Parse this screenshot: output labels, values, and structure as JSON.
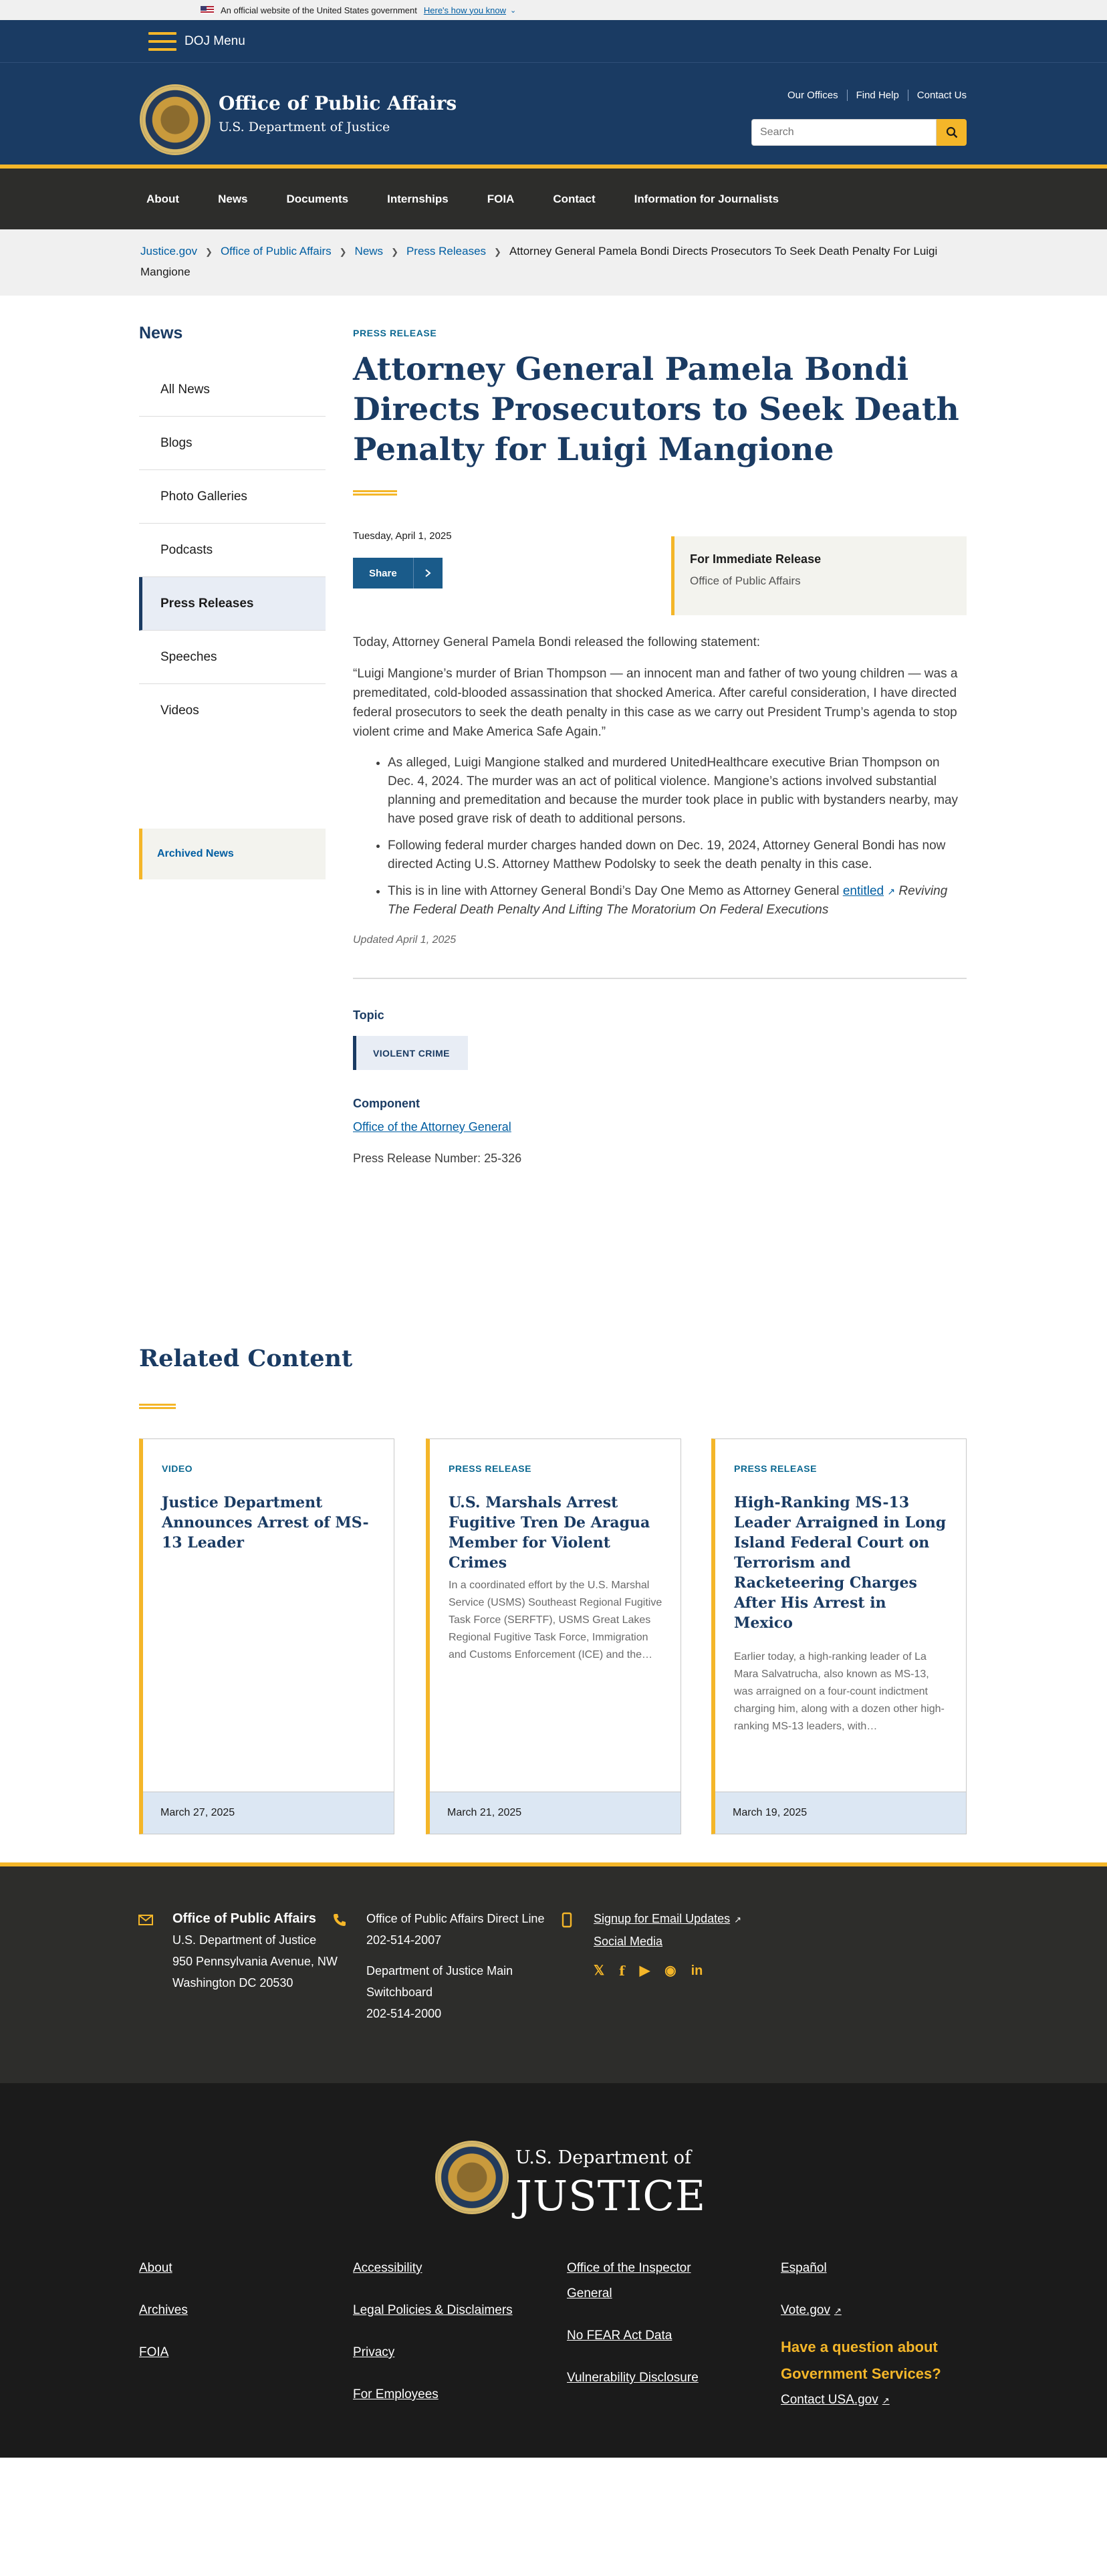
{
  "gov_banner": {
    "text": "An official website of the United States government",
    "link": "Here's how you know"
  },
  "menu": {
    "label": "DOJ Menu"
  },
  "header": {
    "title": "Office of Public Affairs",
    "subtitle": "U.S. Department of Justice",
    "util_links": [
      "Our Offices",
      "Find Help",
      "Contact Us"
    ],
    "search_placeholder": "Search"
  },
  "nav": [
    "About",
    "News",
    "Documents",
    "Internships",
    "FOIA",
    "Contact",
    "Information for Journalists"
  ],
  "breadcrumb": {
    "items": [
      "Justice.gov",
      "Office of Public Affairs",
      "News",
      "Press Releases"
    ],
    "current": "Attorney General Pamela Bondi Directs Prosecutors To Seek Death Penalty For Luigi Mangione"
  },
  "sidebar": {
    "title": "News",
    "items": [
      "All News",
      "Blogs",
      "Photo Galleries",
      "Podcasts",
      "Press Releases",
      "Speeches",
      "Videos"
    ],
    "active": "Press Releases",
    "archived": "Archived News"
  },
  "article": {
    "eyebrow": "PRESS RELEASE",
    "title": "Attorney General Pamela Bondi Directs Prosecutors to Seek Death Penalty for Luigi Mangione",
    "date": "Tuesday, April 1, 2025",
    "share": "Share",
    "release_title": "For Immediate Release",
    "release_office": "Office of Public Affairs",
    "intro": "Today, Attorney General Pamela Bondi released the following statement:",
    "quote": "“Luigi Mangione’s murder of Brian Thompson — an innocent man and father of two young children — was a premeditated, cold-blooded assassination that shocked America. After careful consideration, I have directed federal prosecutors to seek the death penalty in this case as we carry out President Trump’s agenda to stop violent crime and Make America Safe Again.”",
    "bullets": [
      "As alleged, Luigi Mangione stalked and murdered UnitedHealthcare executive Brian Thompson on Dec. 4, 2024. The murder was an act of political violence. Mangione’s actions involved substantial planning and premeditation and because the murder took place in public with bystanders nearby, may have posed grave risk of death to additional persons.",
      "Following federal murder charges handed down on Dec. 19, 2024, Attorney General Bondi has now directed Acting U.S. Attorney Matthew Podolsky to seek the death penalty in this case."
    ],
    "bullet3_prefix": "This is in line with Attorney General Bondi’s Day One Memo as Attorney General ",
    "bullet3_link": "entitled",
    "bullet3_italic": "Reviving The Federal Death Penalty And Lifting The Moratorium On Federal Executions",
    "updated": "Updated April 1, 2025",
    "topic_label": "Topic",
    "topic": "VIOLENT CRIME",
    "component_label": "Component",
    "component": "Office of the Attorney General",
    "release_number": "Press Release Number: 25-326"
  },
  "related": {
    "title": "Related Content",
    "cards": [
      {
        "type": "VIDEO",
        "title": "Justice Department Announces Arrest of MS-13 Leader",
        "desc": "",
        "date": "March 27, 2025"
      },
      {
        "type": "PRESS RELEASE",
        "title": "U.S. Marshals Arrest Fugitive Tren De Aragua Member for Violent Crimes",
        "desc": "In a coordinated effort by the U.S. Marshal Service (USMS) Southeast Regional Fugitive Task Force (SERFTF), USMS Great Lakes Regional Fugitive Task Force, Immigration and Customs Enforcement (ICE) and the…",
        "date": "March 21, 2025"
      },
      {
        "type": "PRESS RELEASE",
        "title": "High-Ranking MS-13 Leader Arraigned in Long Island Federal Court on Terrorism and Racketeering Charges After His Arrest in Mexico",
        "desc": "Earlier today, a high-ranking leader of La Mara Salvatrucha, also known as MS-13, was arraigned on a four-count indictment charging him, along with a dozen other high-ranking MS-13 leaders, with…",
        "date": "March 19, 2025"
      }
    ]
  },
  "footer_contact": {
    "office": "Office of Public Affairs",
    "address": [
      "U.S. Department of Justice",
      "950 Pennsylvania Avenue, NW",
      "Washington DC 20530"
    ],
    "direct_label": "Office of Public Affairs Direct Line",
    "direct_phone": "202-514-2007",
    "switch_label": "Department of Justice Main Switchboard",
    "switch_phone": "202-514-2000",
    "email_updates": "Signup for Email Updates",
    "social_media": "Social Media"
  },
  "footer": {
    "dept_top": "U.S. Department of",
    "dept_big": "JUSTICE",
    "col1": [
      "About",
      "Archives",
      "FOIA"
    ],
    "col2": [
      "Accessibility",
      "Legal Policies & Disclaimers",
      "Privacy",
      "For Employees"
    ],
    "col3": [
      "Office of the Inspector General",
      "No FEAR Act Data",
      "Vulnerability Disclosure"
    ],
    "col4": [
      "Español",
      "Vote.gov"
    ],
    "question": "Have a question about Government Services?",
    "contact_usa": "Contact USA.gov"
  },
  "colors": {
    "navy": "#1a3b63",
    "gold": "#f4b629",
    "link": "#005ea2",
    "dark": "#2d2d2b"
  }
}
